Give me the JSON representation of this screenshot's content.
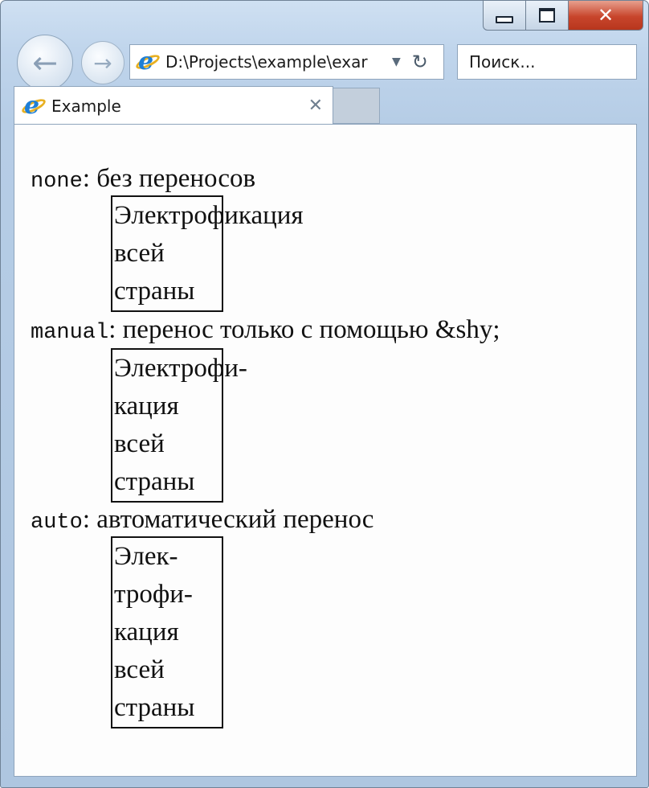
{
  "window": {
    "minimize_icon": "minimize-icon",
    "maximize_icon": "maximize-icon",
    "close_glyph": "✕"
  },
  "nav": {
    "back_glyph": "←",
    "forward_glyph": "→"
  },
  "address": {
    "url": "D:\\Projects\\example\\exar",
    "dropdown_glyph": "▼",
    "refresh_glyph": "↻"
  },
  "search": {
    "placeholder": "Поиск..."
  },
  "tab": {
    "label": "Example",
    "close_glyph": "✕"
  },
  "content": {
    "sections": [
      {
        "keyword": "none",
        "description": ": без переносов",
        "lines": [
          "Электрофикация",
          "всей",
          "страны"
        ]
      },
      {
        "keyword": "manual",
        "description": ": перенос только с помощью &shy;",
        "lines": [
          "Электрофи-",
          "кация",
          "всей",
          "страны"
        ]
      },
      {
        "keyword": "auto",
        "description": ": автоматический перенос",
        "lines": [
          "Элек-",
          "трофи-",
          "кация",
          "всей",
          "страны"
        ]
      }
    ]
  },
  "colors": {
    "close_button": "#c8452c",
    "frame": "#b6cde6",
    "ie_blue": "#1f7fd6",
    "ie_ring": "#e8b021"
  }
}
